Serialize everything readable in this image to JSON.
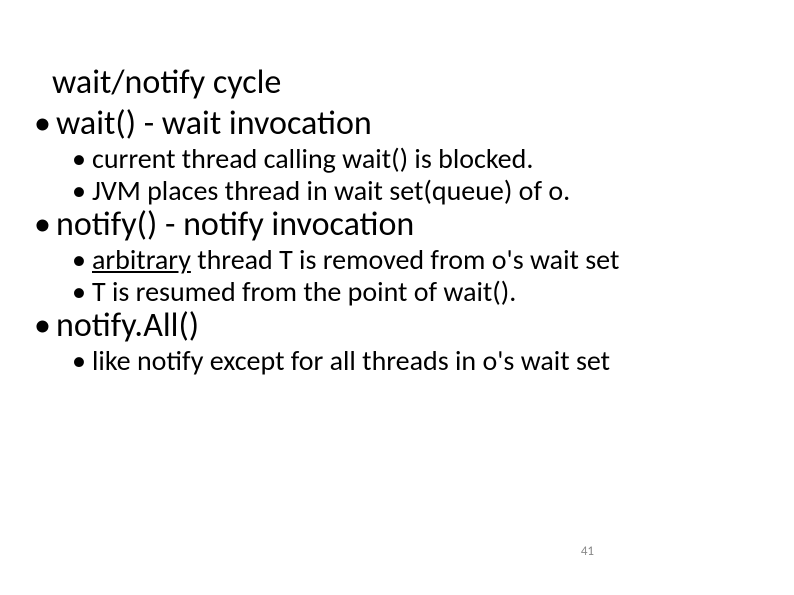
{
  "title": "wait/notify cycle",
  "items": [
    {
      "text": "wait() - wait invocation",
      "sub": [
        "current thread calling wait() is blocked.",
        "JVM places thread in wait set(queue) of o."
      ]
    },
    {
      "text": "notify() - notify invocation",
      "sub_parts": [
        {
          "pre": "",
          "underlined": "arbitrary",
          "post": " thread T is removed from o's wait set"
        },
        {
          "pre": "T is resumed from the point of wait().",
          "underlined": "",
          "post": ""
        }
      ]
    },
    {
      "text": "notify.All()",
      "sub": [
        "like notify except for all threads in o's wait set"
      ]
    }
  ],
  "page_number": "41",
  "bullet": "•"
}
